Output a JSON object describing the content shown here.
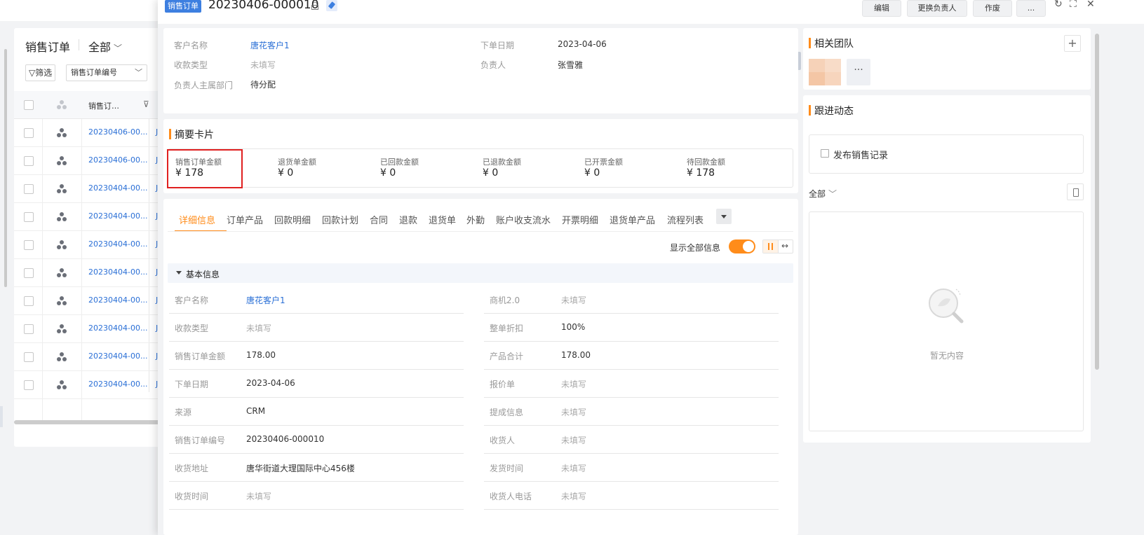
{
  "list": {
    "title": "销售订单",
    "scope": "全部",
    "filter_label": "▽筛选",
    "field_select": "销售订单编号",
    "head_label": "销售订…",
    "rows": [
      {
        "no": "20230406-00...",
        "trail": "J"
      },
      {
        "no": "20230406-00...",
        "trail": "J"
      },
      {
        "no": "20230404-00...",
        "trail": "J"
      },
      {
        "no": "20230404-00...",
        "trail": "J"
      },
      {
        "no": "20230404-00...",
        "trail": "J"
      },
      {
        "no": "20230404-00...",
        "trail": "J"
      },
      {
        "no": "20230404-00...",
        "trail": "J"
      },
      {
        "no": "20230404-00...",
        "trail": "J"
      },
      {
        "no": "20230404-00...",
        "trail": "J"
      },
      {
        "no": "20230404-00...",
        "trail": "J"
      }
    ]
  },
  "header": {
    "object_tag": "销售订单",
    "record_no": "20230406-000010",
    "buttons": {
      "edit": "编辑",
      "change_owner": "更换负责人",
      "void": "作废",
      "more": "..."
    },
    "icons": {
      "refresh": "↻",
      "fullscreen": "⛶",
      "close": "✕"
    }
  },
  "top_info": {
    "customer_label": "客户名称",
    "customer_value": "唐花客户1",
    "order_date_label": "下单日期",
    "order_date_value": "2023-04-06",
    "payment_type_label": "收款类型",
    "payment_type_value": "未填写",
    "owner_label": "负责人",
    "owner_value": "张雪雅",
    "owner_dept_label": "负责人主属部门",
    "owner_dept_value": "待分配"
  },
  "summary": {
    "title": "摘要卡片",
    "cards": [
      {
        "label": "销售订单金额",
        "value": "¥ 178"
      },
      {
        "label": "退货单金额",
        "value": "¥ 0"
      },
      {
        "label": "已回款金额",
        "value": "¥ 0"
      },
      {
        "label": "已退款金额",
        "value": "¥ 0"
      },
      {
        "label": "已开票金额",
        "value": "¥ 0"
      },
      {
        "label": "待回款金额",
        "value": "¥ 178"
      }
    ]
  },
  "tabs": [
    "详细信息",
    "订单产品",
    "回款明细",
    "回款计划",
    "合同",
    "退款",
    "退货单",
    "外勤",
    "账户收支流水",
    "开票明细",
    "退货单产品",
    "流程列表"
  ],
  "detail": {
    "show_all_label": "显示全部信息",
    "show_all_on": true,
    "group_title": "基本信息",
    "left_fields": [
      {
        "label": "客户名称",
        "value": "唐花客户1",
        "kind": "link"
      },
      {
        "label": "收款类型",
        "value": "未填写",
        "kind": "empty"
      },
      {
        "label": "销售订单金额",
        "value": "178.00",
        "kind": "normal"
      },
      {
        "label": "下单日期",
        "value": "2023-04-06",
        "kind": "normal"
      },
      {
        "label": "来源",
        "value": "CRM",
        "kind": "normal"
      },
      {
        "label": "销售订单编号",
        "value": "20230406-000010",
        "kind": "normal"
      },
      {
        "label": "收货地址",
        "value": "唐华街道大理国际中心456楼",
        "kind": "normal"
      },
      {
        "label": "收货时间",
        "value": "未填写",
        "kind": "empty"
      }
    ],
    "right_fields": [
      {
        "label": "商机2.0",
        "value": "未填写",
        "kind": "empty"
      },
      {
        "label": "整单折扣",
        "value": "100%",
        "kind": "normal"
      },
      {
        "label": "产品合计",
        "value": "178.00",
        "kind": "normal"
      },
      {
        "label": "报价单",
        "value": "未填写",
        "kind": "empty"
      },
      {
        "label": "提成信息",
        "value": "未填写",
        "kind": "empty"
      },
      {
        "label": "收货人",
        "value": "未填写",
        "kind": "empty"
      },
      {
        "label": "发货时间",
        "value": "未填写",
        "kind": "empty"
      },
      {
        "label": "收货人电话",
        "value": "未填写",
        "kind": "empty"
      }
    ]
  },
  "team": {
    "title": "相关团队",
    "add": "+",
    "more": "···"
  },
  "followup": {
    "title": "跟进动态",
    "publish": "发布销售记录",
    "filter": "全部",
    "empty_text": "暂无内容"
  },
  "colors": {
    "accent": "#ff8c1a",
    "link": "#2a6fd6",
    "tag": "#3d7fe0",
    "highlight": "#e02020"
  }
}
